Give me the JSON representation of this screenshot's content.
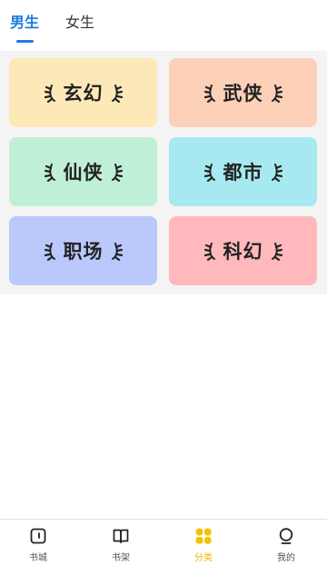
{
  "tabs": [
    {
      "label": "男生",
      "active": true
    },
    {
      "label": "女生",
      "active": false
    }
  ],
  "categories": [
    {
      "label": "玄幻",
      "color": "#fde9b8"
    },
    {
      "label": "武侠",
      "color": "#fdd0b8"
    },
    {
      "label": "仙侠",
      "color": "#bfefd6"
    },
    {
      "label": "都市",
      "color": "#a6e9f0"
    },
    {
      "label": "职场",
      "color": "#bac8fc"
    },
    {
      "label": "科幻",
      "color": "#ffb9bd"
    }
  ],
  "bottom_nav": [
    {
      "label": "书城",
      "icon": "store-icon",
      "active": false
    },
    {
      "label": "书架",
      "icon": "bookshelf-icon",
      "active": false
    },
    {
      "label": "分类",
      "icon": "category-icon",
      "active": true
    },
    {
      "label": "我的",
      "icon": "profile-icon",
      "active": false
    }
  ],
  "colors": {
    "accent": "#1f7be0",
    "nav_active": "#f0b400"
  }
}
